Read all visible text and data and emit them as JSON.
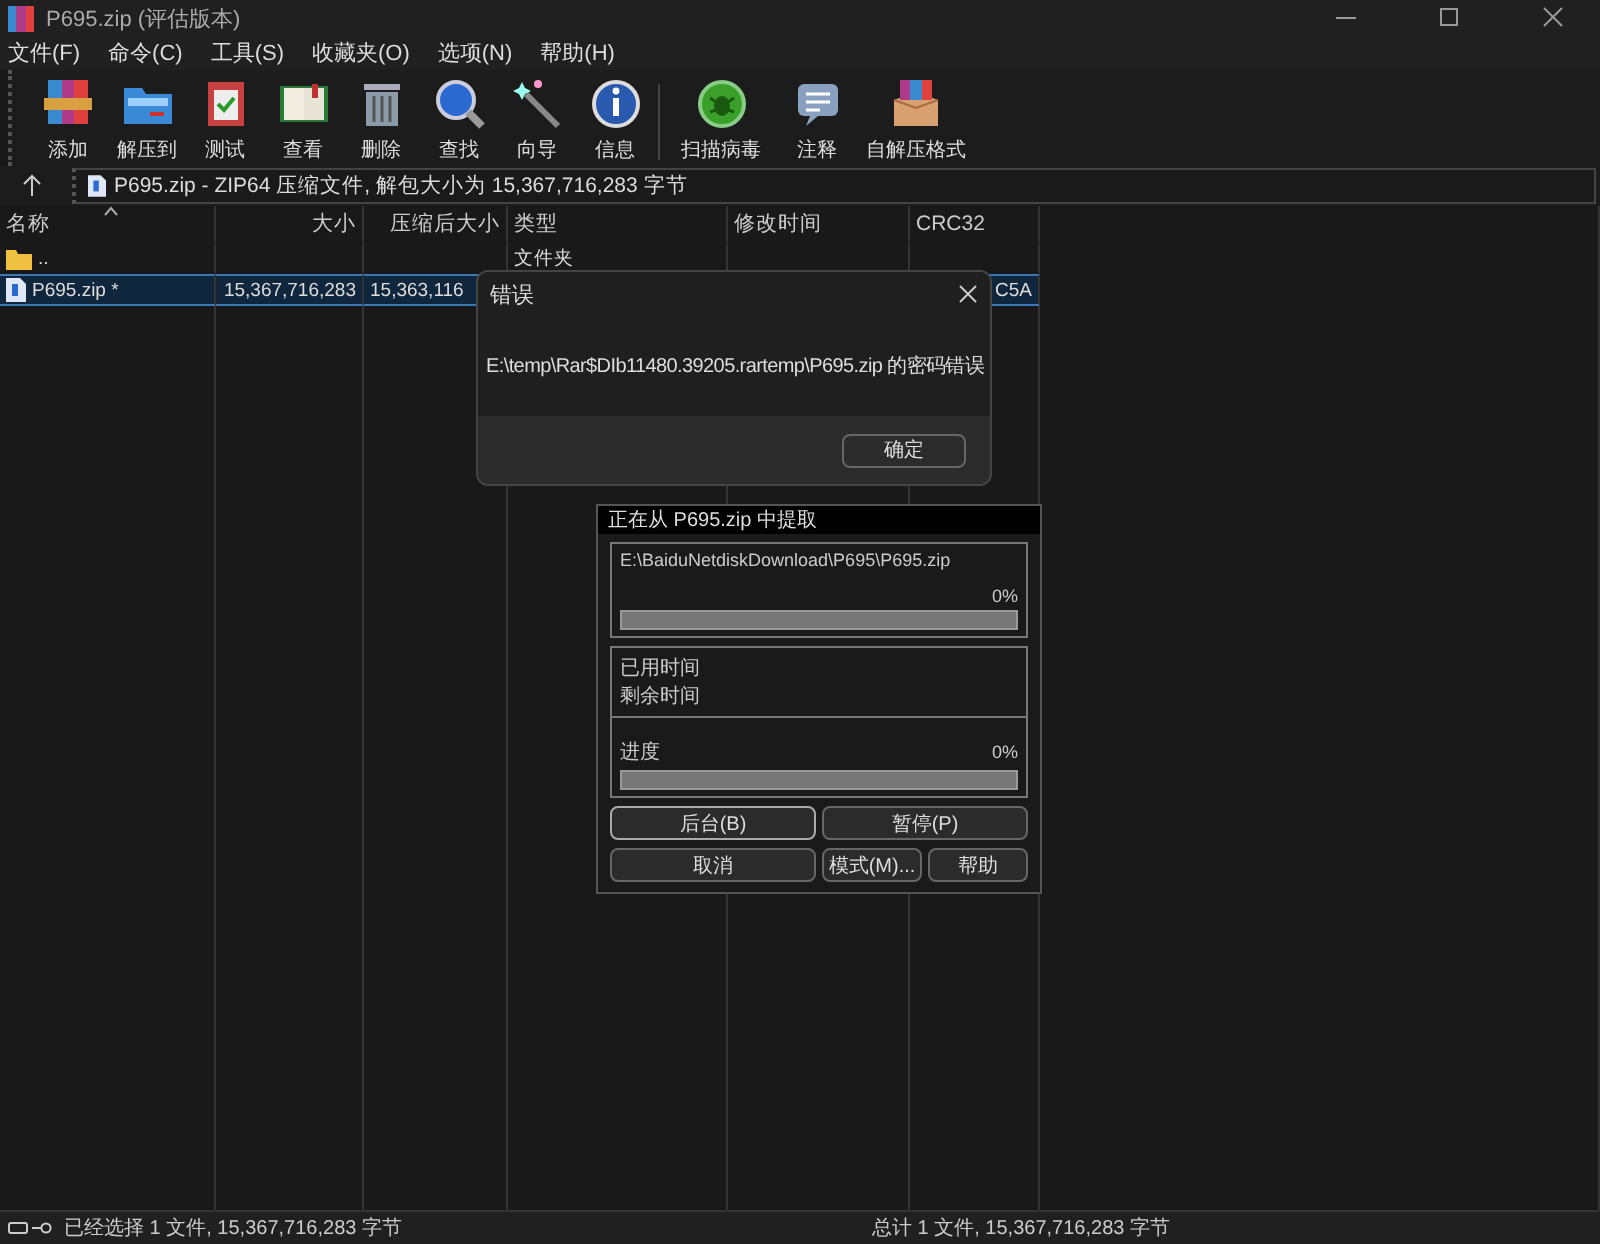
{
  "window": {
    "title": "P695.zip (评估版本)"
  },
  "menu": [
    "文件(F)",
    "命令(C)",
    "工具(S)",
    "收藏夹(O)",
    "选项(N)",
    "帮助(H)"
  ],
  "toolbar": [
    {
      "label": "添加"
    },
    {
      "label": "解压到"
    },
    {
      "label": "测试"
    },
    {
      "label": "查看"
    },
    {
      "label": "删除"
    },
    {
      "label": "查找"
    },
    {
      "label": "向导"
    },
    {
      "label": "信息"
    },
    {
      "label": "扫描病毒"
    },
    {
      "label": "注释"
    },
    {
      "label": "自解压格式"
    }
  ],
  "address": "P695.zip - ZIP64 压缩文件, 解包大小为 15,367,716,283 字节",
  "table": {
    "columns": [
      {
        "label": "名称",
        "sorted": true
      },
      {
        "label": "大小",
        "sorted": false
      },
      {
        "label": "压缩后大小",
        "sorted": false
      },
      {
        "label": "类型",
        "sorted": false
      },
      {
        "label": "修改时间",
        "sorted": false
      },
      {
        "label": "CRC32",
        "sorted": false
      }
    ],
    "rows": [
      {
        "kind": "folder",
        "selected": false,
        "cells": [
          "..",
          "",
          "",
          "文件夹",
          "",
          ""
        ]
      },
      {
        "kind": "file",
        "selected": true,
        "cells": [
          "P695.zip *",
          "15,367,716,283",
          "15,363,116",
          "",
          "",
          "C5A"
        ]
      }
    ]
  },
  "error_dialog": {
    "title": "错误",
    "message": "E:\\temp\\Rar$DIb11480.39205.rartemp\\P695.zip 的密码错误",
    "button": "确定"
  },
  "progress_dialog": {
    "title": "正在从 P695.zip 中提取",
    "path": "E:\\BaiduNetdiskDownload\\P695\\P695.zip",
    "file_progress": {
      "percent": "0%",
      "level": 0
    },
    "elapsed_label": "已用时间",
    "remaining_label": "剩余时间",
    "total_label": "进度",
    "total_progress": {
      "percent": "0%",
      "level": 0
    },
    "buttons": [
      {
        "label": "后台(B)",
        "focused": true
      },
      {
        "label": "暂停(P)",
        "focused": false
      },
      {
        "label": "取消",
        "focused": false
      },
      {
        "label": "模式(M)...",
        "focused": false
      },
      {
        "label": "帮助",
        "focused": false
      }
    ]
  },
  "status_bar": {
    "left": "已经选择 1 文件, 15,367,716,283 字节",
    "right": "总计 1 文件, 15,367,716,283 字节"
  }
}
